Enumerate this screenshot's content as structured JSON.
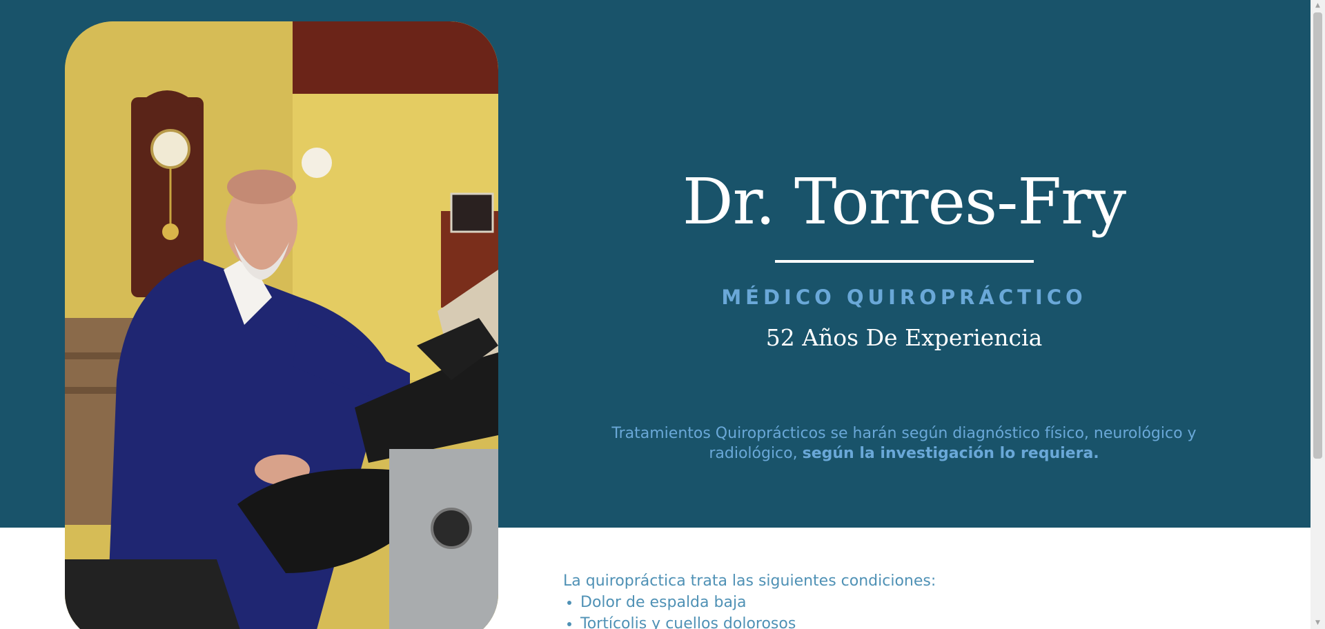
{
  "hero": {
    "name": "Dr. Torres-Fry",
    "specialty": "MÉDICO QUIROPRÁCTICO",
    "experience": "52 Años De Experiencia",
    "treatment_text": "Tratamientos Quiroprácticos se harán según diagnóstico físico, neurológico y radiológico, ",
    "treatment_bold": "según la investigación lo requiera.",
    "photo_icon": "doctor-photo"
  },
  "conditions": {
    "intro": "La quiropráctica trata las siguientes condiciones:",
    "items": [
      "Dolor de espalda baja",
      "Tortícolis y cuellos dolorosos"
    ]
  },
  "colors": {
    "hero_bg": "#19536a",
    "accent": "#6aa8d8",
    "white": "#ffffff"
  }
}
